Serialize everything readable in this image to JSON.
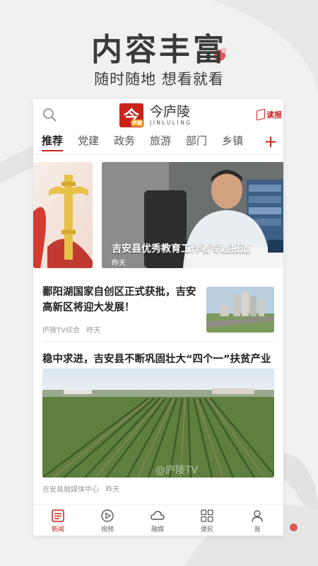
{
  "promo": {
    "title": "内容丰富",
    "subtitle": "随时随地 想看就看"
  },
  "header": {
    "logo_char": "今",
    "logo_mini": "庐陵",
    "brand_name": "今庐陵",
    "brand_pinyin": "JINLULING",
    "read_label": "读报"
  },
  "tabs": [
    "推荐",
    "党建",
    "政务",
    "旅游",
    "部门",
    "乡镇"
  ],
  "add_tab": "+",
  "carousel": {
    "caption": "吉安县优秀教育工作者专题报道",
    "time": "昨天"
  },
  "articles": [
    {
      "title": "鄱阳湖国家自创区正式获批，吉安高新区将迎大发展！",
      "source": "庐陵TV综合",
      "time": "昨天"
    },
    {
      "title": "稳中求进，吉安县不断巩固壮大“四个一”扶贫产业",
      "source": "吉安县融媒体中心",
      "time": "昨天",
      "watermark": "@庐陵TV"
    }
  ],
  "bottom_nav": [
    {
      "label": "新闻",
      "icon": "news-icon",
      "active": true
    },
    {
      "label": "视频",
      "icon": "play-icon",
      "active": false
    },
    {
      "label": "融媒",
      "icon": "cloud-icon",
      "active": false
    },
    {
      "label": "便民",
      "icon": "grid-icon",
      "active": false
    },
    {
      "label": "我",
      "icon": "person-icon",
      "active": false
    }
  ],
  "colors": {
    "accent": "#c8231c",
    "background": "#f1f1f1"
  }
}
